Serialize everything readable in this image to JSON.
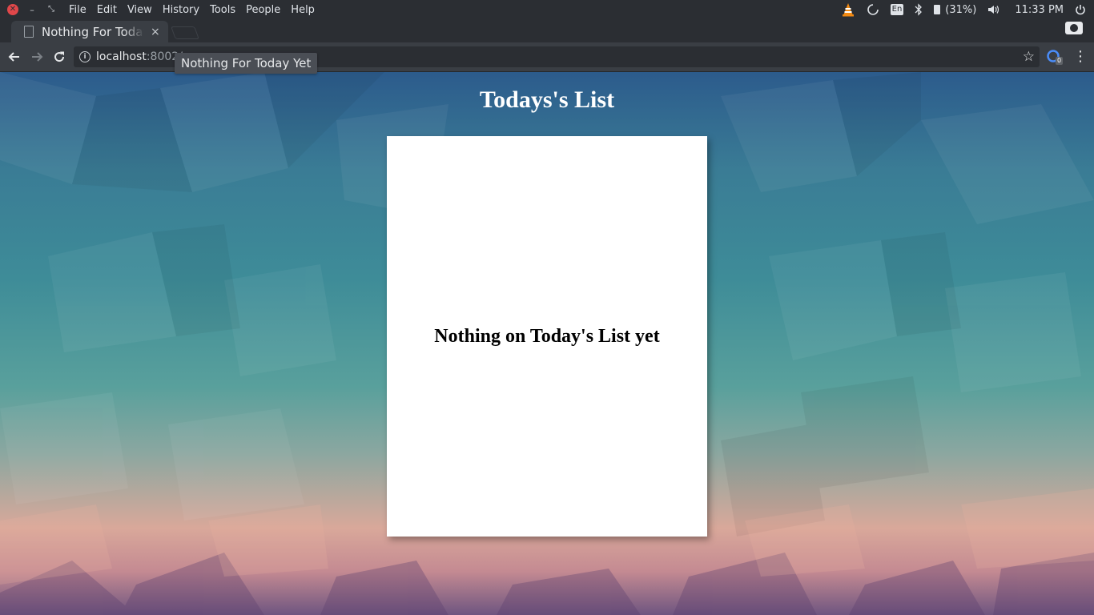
{
  "menubar": {
    "items": [
      "File",
      "Edit",
      "View",
      "History",
      "Tools",
      "People",
      "Help"
    ],
    "tray": {
      "language": "En",
      "battery": "(31%)",
      "clock": "11:33 PM"
    }
  },
  "tab": {
    "title": "Nothing For Today Yet",
    "close_glyph": "×"
  },
  "toolbar": {
    "url_host": "localhost",
    "url_rest": ":8002/",
    "extension_badge": "0"
  },
  "tooltip": "Nothing For Today Yet",
  "page": {
    "heading": "Todays's List",
    "empty_message": "Nothing on Today's List yet"
  },
  "colors": {
    "accent_close": "#e0474a",
    "card_background": "#ffffff",
    "heading_text": "#ffffff"
  }
}
